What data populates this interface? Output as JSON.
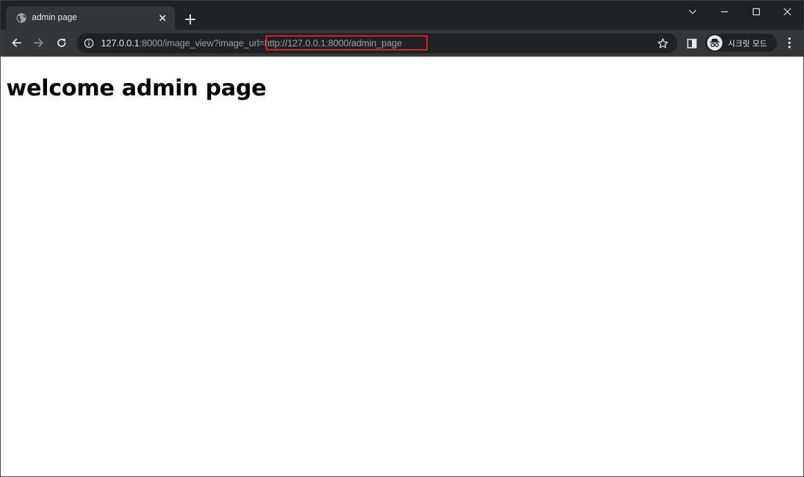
{
  "tab": {
    "title": "admin page"
  },
  "address_bar": {
    "host": "127.0.0.1",
    "path_prefix": ":8000/image_view?image_url",
    "path_suffix": "=http://127.0.0.1:8000/admin_page"
  },
  "profile": {
    "label": "시크릿 모드"
  },
  "page": {
    "heading": "welcome admin page"
  },
  "colors": {
    "highlight": "#e0201c",
    "frame": "#202124",
    "toolbar": "#35363a"
  },
  "icons": {
    "tab_favicon": "globe-icon",
    "tab_close": "close-icon",
    "new_tab": "plus-icon",
    "back": "arrow-left-icon",
    "forward": "arrow-right-icon",
    "reload": "reload-icon",
    "site_info": "info-icon",
    "bookmark": "star-icon",
    "side_panel": "side-panel-icon",
    "incognito": "incognito-icon",
    "menu": "kebab-menu-icon",
    "tab_search": "chevron-down-icon",
    "minimize": "minimize-icon",
    "maximize": "maximize-icon",
    "close_window": "close-window-icon"
  }
}
